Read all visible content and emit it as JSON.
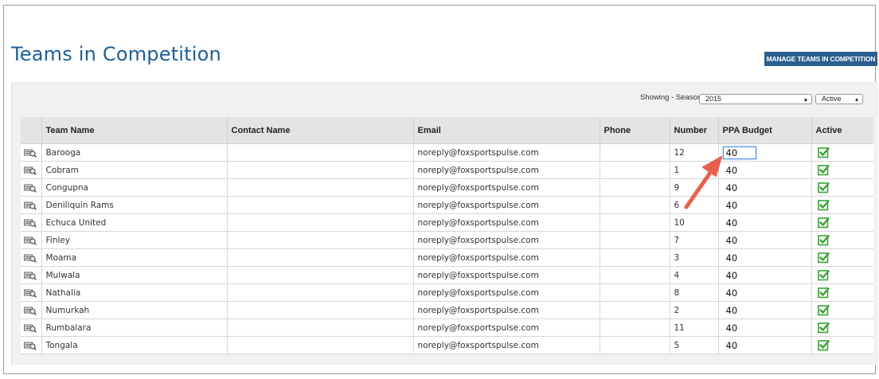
{
  "page": {
    "title": "Teams in Competition",
    "manage_button_label": "MANAGE TEAMS IN COMPETITION"
  },
  "filters": {
    "label": "Showing - Season",
    "season_value": "2015",
    "status_value": "Active"
  },
  "table": {
    "columns": [
      "Team Name",
      "Contact Name",
      "Email",
      "Phone",
      "Number",
      "PPA Budget",
      "Active"
    ],
    "rows": [
      {
        "team": "Barooga",
        "contact": "",
        "email": "noreply@foxsportspulse.com",
        "phone": "",
        "number": "12",
        "budget": "40",
        "active": true
      },
      {
        "team": "Cobram",
        "contact": "",
        "email": "noreply@foxsportspulse.com",
        "phone": "",
        "number": "1",
        "budget": "40",
        "active": true
      },
      {
        "team": "Congupna",
        "contact": "",
        "email": "noreply@foxsportspulse.com",
        "phone": "",
        "number": "9",
        "budget": "40",
        "active": true
      },
      {
        "team": "Deniliquin Rams",
        "contact": "",
        "email": "noreply@foxsportspulse.com",
        "phone": "",
        "number": "6",
        "budget": "40",
        "active": true
      },
      {
        "team": "Echuca United",
        "contact": "",
        "email": "noreply@foxsportspulse.com",
        "phone": "",
        "number": "10",
        "budget": "40",
        "active": true
      },
      {
        "team": "Finley",
        "contact": "",
        "email": "noreply@foxsportspulse.com",
        "phone": "",
        "number": "7",
        "budget": "40",
        "active": true
      },
      {
        "team": "Moama",
        "contact": "",
        "email": "noreply@foxsportspulse.com",
        "phone": "",
        "number": "3",
        "budget": "40",
        "active": true
      },
      {
        "team": "Mulwala",
        "contact": "",
        "email": "noreply@foxsportspulse.com",
        "phone": "",
        "number": "4",
        "budget": "40",
        "active": true
      },
      {
        "team": "Nathalia",
        "contact": "",
        "email": "noreply@foxsportspulse.com",
        "phone": "",
        "number": "8",
        "budget": "40",
        "active": true
      },
      {
        "team": "Numurkah",
        "contact": "",
        "email": "noreply@foxsportspulse.com",
        "phone": "",
        "number": "2",
        "budget": "40",
        "active": true
      },
      {
        "team": "Rumbalara",
        "contact": "",
        "email": "noreply@foxsportspulse.com",
        "phone": "",
        "number": "11",
        "budget": "40",
        "active": true
      },
      {
        "team": "Tongala",
        "contact": "",
        "email": "noreply@foxsportspulse.com",
        "phone": "",
        "number": "5",
        "budget": "40",
        "active": true
      }
    ]
  },
  "colors": {
    "title": "#1f5f97",
    "button_bg": "#2a5f8f",
    "check": "#3aa335",
    "annotation_arrow": "#e8604c"
  },
  "icons": {
    "row_view": "view-details-icon",
    "active": "checkbox-checked-icon",
    "annotation": "annotation-arrow-icon"
  }
}
